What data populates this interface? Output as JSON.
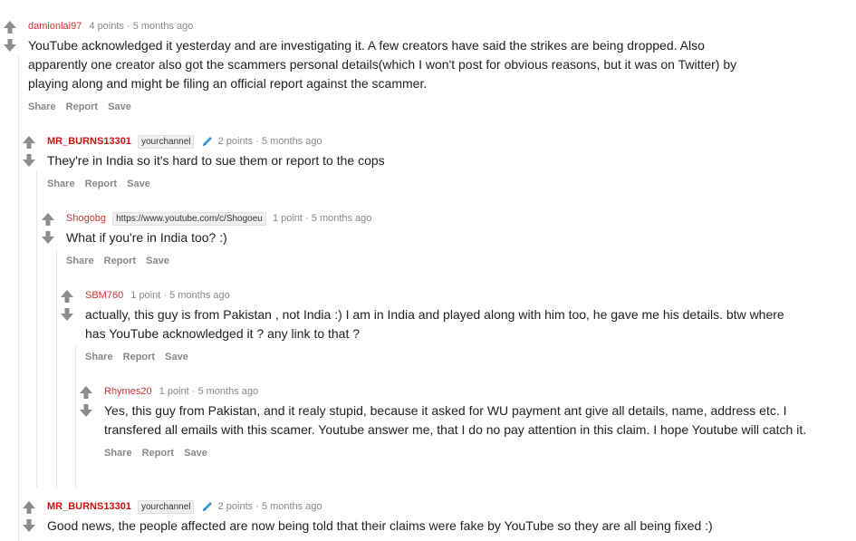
{
  "actions": {
    "share": "Share",
    "report": "Report",
    "save": "Save"
  },
  "comments": [
    {
      "author": "damionlai97",
      "flair": "",
      "score": "4 points",
      "sep": "·",
      "time": "5 months ago",
      "text": "YouTube acknowledged it yesterday and are investigating it. A few creators have said the strikes are being dropped. Also apparently one creator also got the scammers personal details(which I won't post for obvious reasons, but it was on Twitter) by playing along and might be filing an official report against the scammer."
    },
    {
      "author": "MR_BURNS13301",
      "flair": "yourchannel",
      "score": "2 points",
      "sep": "·",
      "time": "5 months ago",
      "text": "They're in India so it's hard to sue them or report to the cops"
    },
    {
      "author": "Shogobg",
      "flair": "https://www.youtube.com/c/Shogoeu",
      "score": "1 point",
      "sep": "·",
      "time": "5 months ago",
      "text": "What if you're in India too? :)"
    },
    {
      "author": "SBM760",
      "flair": "",
      "score": "1 point",
      "sep": "·",
      "time": "5 months ago",
      "text": "actually, this guy is from Pakistan , not India :) I am in India and played along with him too, he gave me his details. btw where has YouTube acknowledged it ? any link to that ?"
    },
    {
      "author": "Rhymes20",
      "flair": "",
      "score": "1 point",
      "sep": "·",
      "time": "5 months ago",
      "text": "Yes, this guy from Pakistan, and it realy stupid, because it asked for WU payment ant give all details, name, address etc. I transfered all emails with this scamer. Youtube answer me, that I do no pay attention in this claim. I hope Youtube will catch it."
    },
    {
      "author": "MR_BURNS13301",
      "flair": "yourchannel",
      "score": "2 points",
      "sep": "·",
      "time": "5 months ago",
      "text": "Good news, the people affected are now being told that their claims were fake by YouTube so they are all being fixed :)"
    }
  ]
}
